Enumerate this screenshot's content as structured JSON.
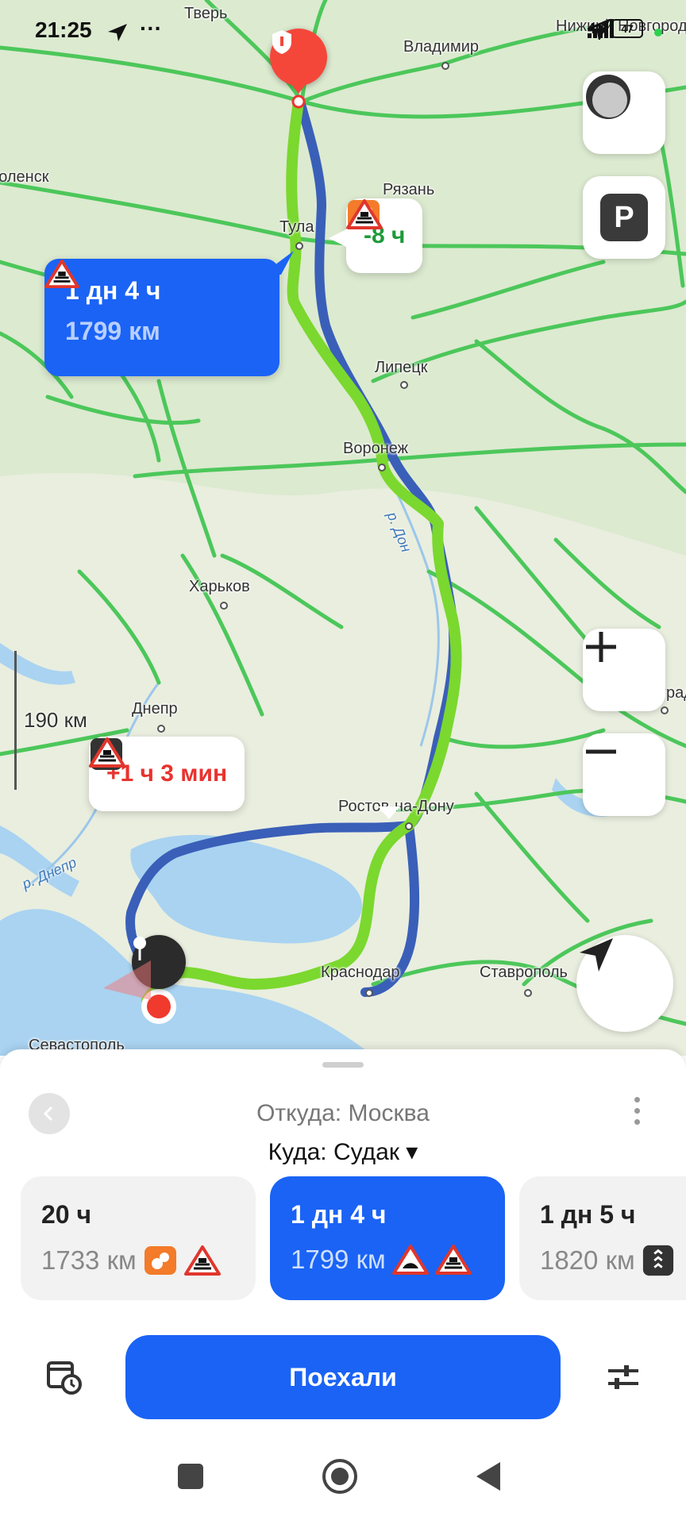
{
  "status_bar": {
    "time": "21:25",
    "dots": "···",
    "network": "4G",
    "battery": "47"
  },
  "map": {
    "cities": [
      {
        "name": "Тверь"
      },
      {
        "name": "Владимир"
      },
      {
        "name": "Нижний Новгород"
      },
      {
        "name": "Рязань"
      },
      {
        "name": "Тула"
      },
      {
        "name": "Липецк"
      },
      {
        "name": "Воронеж"
      },
      {
        "name": "Харьков"
      },
      {
        "name": "Днепр"
      },
      {
        "name": "Ростов-на-Дону"
      },
      {
        "name": "Краснодар"
      },
      {
        "name": "Ставрополь"
      },
      {
        "name": "Севастополь"
      },
      {
        "name": "Волгоград"
      },
      {
        "name": "Смоленск"
      }
    ],
    "rivers": {
      "don": "р. Дон",
      "dnepr": "р. Днепр"
    },
    "scale_label": "190 км",
    "parking_label": "P",
    "callout_top": {
      "text": "-8 ч",
      "color": "#1e9a3a"
    },
    "callout_main": {
      "time": "1 дн 4 ч",
      "dist": "1799 км"
    },
    "callout_bottom": {
      "text": "+1 ч 3 мин",
      "color": "#e8332f"
    }
  },
  "sheet": {
    "from": "Откуда: Москва",
    "to": "Куда: Судак ▾",
    "routes": [
      {
        "time": "20 ч",
        "dist": "1733 км",
        "icons": [
          "toll-icon",
          "warning-bumps-icon"
        ]
      },
      {
        "time": "1 дн 4 ч",
        "dist": "1799 км",
        "icons": [
          "warning-road-icon",
          "warning-bumps-icon"
        ],
        "active": true
      },
      {
        "time": "1 дн 5 ч",
        "dist": "1820 км",
        "icons": [
          "traffic-light-icon"
        ]
      }
    ],
    "go_label": "Поехали"
  },
  "colors": {
    "accent": "#1a63f5",
    "route_green": "#7bd82e",
    "route_blue": "#3a5fb8",
    "water": "#a9d3f1"
  }
}
